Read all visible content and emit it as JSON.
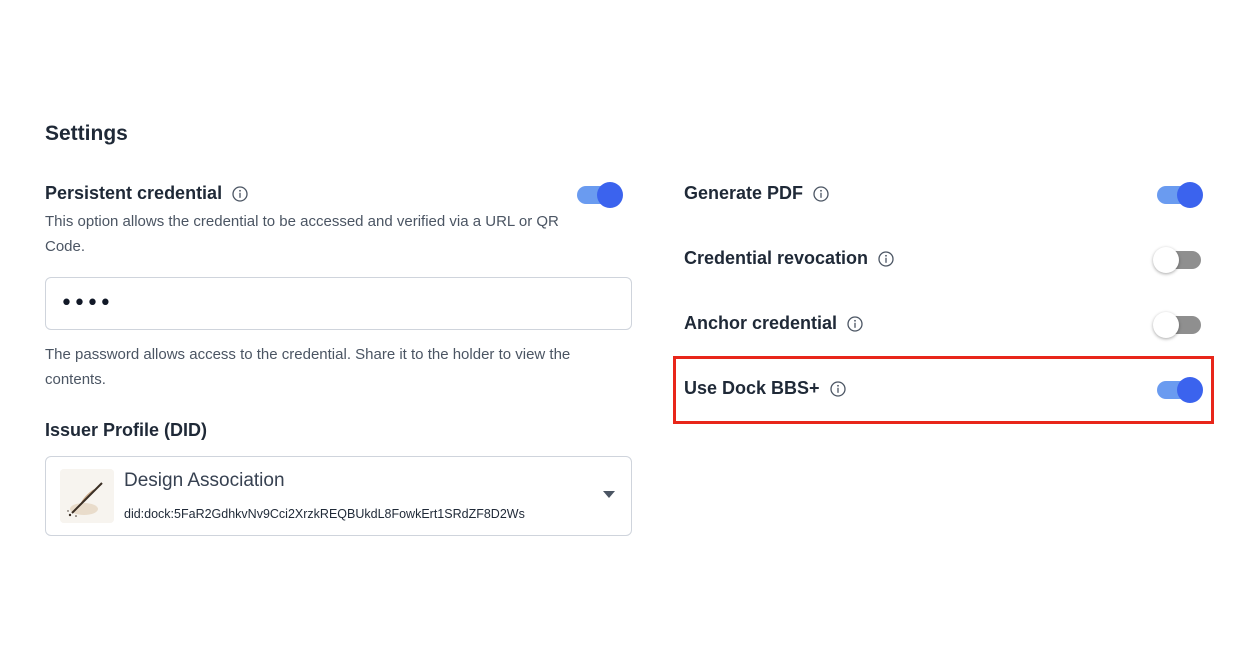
{
  "settings": {
    "title": "Settings",
    "persistent": {
      "label": "Persistent credential",
      "enabled": true,
      "description": "This option allows the credential to be accessed and verified via a URL or QR Code.",
      "password_value": "••••",
      "password_help": "The password allows access to the credential. Share it to the holder to view the contents."
    },
    "issuer": {
      "label": "Issuer Profile (DID)",
      "name": "Design Association",
      "did": "did:dock:5FaR2GdhkvNv9Cci2XrzkREQBUkdL8FowkErt1SRdZF8D2Ws"
    },
    "options": [
      {
        "label": "Generate PDF",
        "enabled": true
      },
      {
        "label": "Credential revocation",
        "enabled": false
      },
      {
        "label": "Anchor credential",
        "enabled": false
      },
      {
        "label": "Use Dock BBS+",
        "enabled": true,
        "highlighted": true
      }
    ]
  },
  "colors": {
    "toggle_on_knob": "#3b63ee",
    "toggle_on_track": "#6a9bf0",
    "toggle_off_track": "#8f8f8f",
    "highlight": "#e8261a"
  },
  "icons": {
    "info": "info-circle-icon",
    "dropdown": "chevron-down-icon",
    "avatar": "quill-pen-icon"
  }
}
